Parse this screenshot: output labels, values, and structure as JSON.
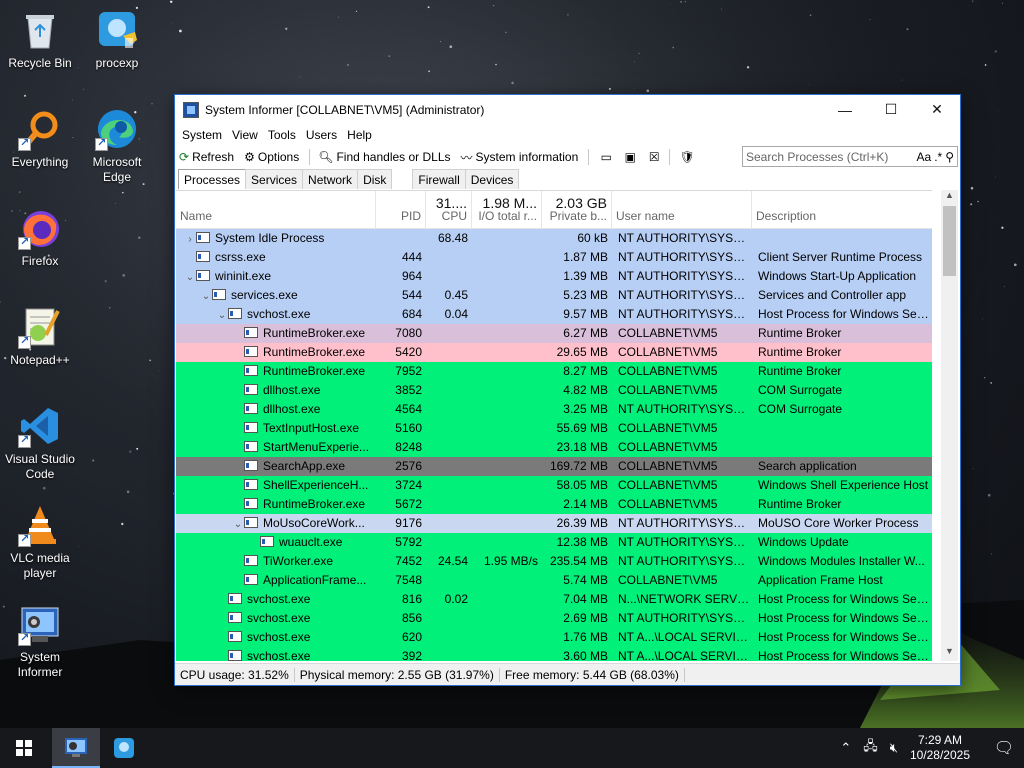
{
  "desktop": {
    "icons": [
      {
        "label": "Recycle Bin",
        "icon": "recycle-bin-icon"
      },
      {
        "label": "procexp",
        "icon": "procexp-icon"
      },
      {
        "label": "Everything",
        "icon": "everything-search-icon"
      },
      {
        "label": "Microsoft\nEdge",
        "label_lines": [
          "Microsoft",
          "Edge"
        ],
        "icon": "edge-icon"
      },
      {
        "label": "Firefox",
        "icon": "firefox-icon"
      },
      {
        "label": "Notepad++",
        "icon": "notepad-plus-plus-icon"
      },
      {
        "label_lines": [
          "Visual Studio",
          "Code"
        ],
        "icon": "vscode-icon"
      },
      {
        "label_lines": [
          "VLC media",
          "player"
        ],
        "icon": "vlc-icon"
      },
      {
        "label_lines": [
          "System",
          "Informer"
        ],
        "icon": "system-informer-icon"
      }
    ]
  },
  "window": {
    "title": "System Informer [COLLABNET\\VM5] (Administrator)",
    "controls": {
      "minimize": "—",
      "maximize": "☐",
      "close": "✕"
    },
    "menu": [
      "System",
      "View",
      "Tools",
      "Users",
      "Help"
    ],
    "toolbar": {
      "refresh": "Refresh",
      "options": "Options",
      "find": "Find handles or DLLs",
      "sysinfo": "System information"
    },
    "search": {
      "placeholder": "Search Processes (Ctrl+K)",
      "case_option": "Aa",
      "regex_option": ".*"
    },
    "tabs": [
      "Processes",
      "Services",
      "Network",
      "Disk",
      "Firewall",
      "Devices"
    ],
    "active_tab": "Processes",
    "columns": {
      "name": "Name",
      "pid": "PID",
      "cpu": "CPU",
      "cpu_total": "31....",
      "io": "I/O total r...",
      "io_total": "1.98 M...",
      "mem": "Private b...",
      "mem_total": "2.03 GB",
      "user": "User name",
      "desc": "Description"
    },
    "colors": {
      "system": "#b8cff5",
      "own": "#d9bfd9",
      "new": "#ffc0cb",
      "service": "#00f07a",
      "suspended": "#7a7a7a",
      "selected": "#c9d8f0"
    },
    "processes": [
      {
        "name": "System Idle Process",
        "pid": "",
        "cpu": "68.48",
        "io": "",
        "mem": "60 kB",
        "user": "NT AUTHORITY\\SYSTEM",
        "desc": "",
        "indent": 0,
        "expander": "›",
        "color": "system"
      },
      {
        "name": "csrss.exe",
        "pid": "444",
        "cpu": "",
        "io": "",
        "mem": "1.87 MB",
        "user": "NT AUTHORITY\\SYSTEM",
        "desc": "Client Server Runtime Process",
        "indent": 0,
        "expander": "",
        "color": "system"
      },
      {
        "name": "wininit.exe",
        "pid": "964",
        "cpu": "",
        "io": "",
        "mem": "1.39 MB",
        "user": "NT AUTHORITY\\SYSTEM",
        "desc": "Windows Start-Up Application",
        "indent": 0,
        "expander": "⌄",
        "color": "system"
      },
      {
        "name": "services.exe",
        "pid": "544",
        "cpu": "0.45",
        "io": "",
        "mem": "5.23 MB",
        "user": "NT AUTHORITY\\SYSTEM",
        "desc": "Services and Controller app",
        "indent": 1,
        "expander": "⌄",
        "color": "system"
      },
      {
        "name": "svchost.exe",
        "pid": "684",
        "cpu": "0.04",
        "io": "",
        "mem": "9.57 MB",
        "user": "NT AUTHORITY\\SYSTEM",
        "desc": "Host Process for Windows Ser...",
        "indent": 2,
        "expander": "⌄",
        "color": "system"
      },
      {
        "name": "RuntimeBroker.exe",
        "pid": "7080",
        "cpu": "",
        "io": "",
        "mem": "6.27 MB",
        "user": "COLLABNET\\VM5",
        "desc": "Runtime Broker",
        "indent": 3,
        "expander": "",
        "color": "own"
      },
      {
        "name": "RuntimeBroker.exe",
        "pid": "5420",
        "cpu": "",
        "io": "",
        "mem": "29.65 MB",
        "user": "COLLABNET\\VM5",
        "desc": "Runtime Broker",
        "indent": 3,
        "expander": "",
        "color": "new"
      },
      {
        "name": "RuntimeBroker.exe",
        "pid": "7952",
        "cpu": "",
        "io": "",
        "mem": "8.27 MB",
        "user": "COLLABNET\\VM5",
        "desc": "Runtime Broker",
        "indent": 3,
        "expander": "",
        "color": "service"
      },
      {
        "name": "dllhost.exe",
        "pid": "3852",
        "cpu": "",
        "io": "",
        "mem": "4.82 MB",
        "user": "COLLABNET\\VM5",
        "desc": "COM Surrogate",
        "indent": 3,
        "expander": "",
        "color": "service"
      },
      {
        "name": "dllhost.exe",
        "pid": "4564",
        "cpu": "",
        "io": "",
        "mem": "3.25 MB",
        "user": "NT AUTHORITY\\SYSTEM",
        "desc": "COM Surrogate",
        "indent": 3,
        "expander": "",
        "color": "service"
      },
      {
        "name": "TextInputHost.exe",
        "pid": "5160",
        "cpu": "",
        "io": "",
        "mem": "55.69 MB",
        "user": "COLLABNET\\VM5",
        "desc": "",
        "indent": 3,
        "expander": "",
        "color": "service"
      },
      {
        "name": "StartMenuExperie...",
        "pid": "8248",
        "cpu": "",
        "io": "",
        "mem": "23.18 MB",
        "user": "COLLABNET\\VM5",
        "desc": "",
        "indent": 3,
        "expander": "",
        "color": "service"
      },
      {
        "name": "SearchApp.exe",
        "pid": "2576",
        "cpu": "",
        "io": "",
        "mem": "169.72 MB",
        "user": "COLLABNET\\VM5",
        "desc": "Search application",
        "indent": 3,
        "expander": "",
        "color": "suspended"
      },
      {
        "name": "ShellExperienceH...",
        "pid": "3724",
        "cpu": "",
        "io": "",
        "mem": "58.05 MB",
        "user": "COLLABNET\\VM5",
        "desc": "Windows Shell Experience Host",
        "indent": 3,
        "expander": "",
        "color": "service"
      },
      {
        "name": "RuntimeBroker.exe",
        "pid": "5672",
        "cpu": "",
        "io": "",
        "mem": "2.14 MB",
        "user": "COLLABNET\\VM5",
        "desc": "Runtime Broker",
        "indent": 3,
        "expander": "",
        "color": "service"
      },
      {
        "name": "MoUsoCoreWork...",
        "pid": "9176",
        "cpu": "",
        "io": "",
        "mem": "26.39 MB",
        "user": "NT AUTHORITY\\SYSTEM",
        "desc": "MoUSO Core Worker Process",
        "indent": 3,
        "expander": "⌄",
        "color": "selected"
      },
      {
        "name": "wuauclt.exe",
        "pid": "5792",
        "cpu": "",
        "io": "",
        "mem": "12.38 MB",
        "user": "NT AUTHORITY\\SYSTEM",
        "desc": "Windows Update",
        "indent": 4,
        "expander": "",
        "color": "service"
      },
      {
        "name": "TiWorker.exe",
        "pid": "7452",
        "cpu": "24.54",
        "io": "1.95 MB/s",
        "mem": "235.54 MB",
        "user": "NT AUTHORITY\\SYSTEM",
        "desc": "Windows Modules Installer W...",
        "indent": 3,
        "expander": "",
        "color": "service"
      },
      {
        "name": "ApplicationFrame...",
        "pid": "7548",
        "cpu": "",
        "io": "",
        "mem": "5.74 MB",
        "user": "COLLABNET\\VM5",
        "desc": "Application Frame Host",
        "indent": 3,
        "expander": "",
        "color": "service"
      },
      {
        "name": "svchost.exe",
        "pid": "816",
        "cpu": "0.02",
        "io": "",
        "mem": "7.04 MB",
        "user": "N...\\NETWORK SERVICE",
        "desc": "Host Process for Windows Ser...",
        "indent": 2,
        "expander": "",
        "color": "service"
      },
      {
        "name": "svchost.exe",
        "pid": "856",
        "cpu": "",
        "io": "",
        "mem": "2.69 MB",
        "user": "NT AUTHORITY\\SYSTEM",
        "desc": "Host Process for Windows Ser...",
        "indent": 2,
        "expander": "",
        "color": "service"
      },
      {
        "name": "svchost.exe",
        "pid": "620",
        "cpu": "",
        "io": "",
        "mem": "1.76 MB",
        "user": "NT A...\\LOCAL SERVICE",
        "desc": "Host Process for Windows Ser...",
        "indent": 2,
        "expander": "",
        "color": "service"
      },
      {
        "name": "svchost.exe",
        "pid": "392",
        "cpu": "",
        "io": "",
        "mem": "3.60 MB",
        "user": "NT A...\\LOCAL SERVICE",
        "desc": "Host Process for Windows Ser...",
        "indent": 2,
        "expander": "",
        "color": "service"
      }
    ],
    "status": {
      "cpu": "CPU usage: 31.52%",
      "physical": "Physical memory: 2.55 GB (31.97%)",
      "free": "Free memory: 5.44 GB (68.03%)"
    }
  },
  "taskbar": {
    "apps": [
      "system-informer-icon",
      "procexp-icon"
    ],
    "clock_time": "7:29 AM",
    "clock_date": "10/28/2025",
    "tray_icons": [
      "chevron-up-icon",
      "network-icon",
      "volume-muted-icon"
    ]
  }
}
